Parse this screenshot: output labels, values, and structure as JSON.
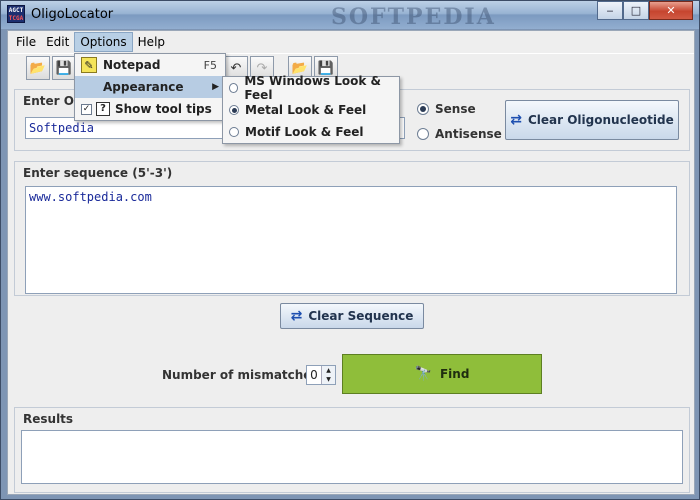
{
  "window": {
    "title": "OligoLocator",
    "watermark": "SOFTPEDIA",
    "app_icon": {
      "line1": "AGCT",
      "line2": "TCGA"
    },
    "controls": {
      "minimize": "‒",
      "maximize": "□",
      "close": "✕"
    }
  },
  "menubar": {
    "file": "File",
    "edit": "Edit",
    "options": "Options",
    "help": "Help"
  },
  "toolbar": {
    "buttons": [
      "open",
      "save",
      "undo",
      "redo",
      "open",
      "save"
    ],
    "glyphs": {
      "open": "📂",
      "save": "💾",
      "undo": "↶",
      "redo": "↷"
    }
  },
  "options_menu": {
    "notepad": {
      "label": "Notepad",
      "accel": "F5",
      "icon": "notepad-icon",
      "glyph": "✎"
    },
    "appearance": {
      "label": "Appearance",
      "arrow": "▶"
    },
    "tooltips": {
      "label": "Show tool tips",
      "checked": true,
      "check_glyph": "✓",
      "help_glyph": "?"
    }
  },
  "appearance_menu": {
    "items": [
      {
        "label": "MS Windows Look & Feel",
        "selected": false
      },
      {
        "label": "Metal Look & Feel",
        "selected": true
      },
      {
        "label": "Motif Look & Feel",
        "selected": false
      }
    ]
  },
  "oligo_panel": {
    "title": "Enter Ol",
    "value": "Softpedia",
    "sense_label": "Sense",
    "antisense_label": "Antisense",
    "selected": "Sense",
    "clear_button": "Clear Oligonucleotide"
  },
  "sequence_panel": {
    "title": "Enter sequence (5'-3')",
    "value": "www.softpedia.com",
    "clear_button": "Clear Sequence"
  },
  "search": {
    "mismatches_label": "Number of mismatches:",
    "mismatches_value": "0",
    "find_button": "Find",
    "find_icon_glyph": "🔭",
    "clear_icon_glyph": "⇄"
  },
  "results": {
    "title": "Results",
    "value": ""
  },
  "colors": {
    "find_button_bg": "#8fbe3a",
    "menu_highlight": "#b7cce3",
    "text_blue": "#1a2a9a"
  }
}
